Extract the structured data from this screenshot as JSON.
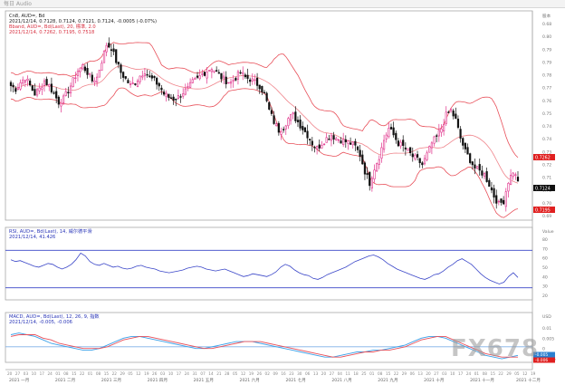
{
  "window": {
    "title": "每日 Audio"
  },
  "watermark": "FX678",
  "colors": {
    "bull": "#e0308a",
    "bear": "#111111",
    "band": "#e8505a",
    "rsi": "#3a46c8",
    "hline": "#3a46c8",
    "macd": "#3aa0e8",
    "signal": "#e8505a",
    "price_box": "#e02020",
    "cur_box": "#111111"
  },
  "panels": {
    "price": {
      "header": [
        "Cn8, AUD=, Bd",
        "2021/12/14, 0.7128, 0.7124, 0.7121, 0.7124, -0.0005 (-0.07%)",
        "Bband, AUD=, Bd(Last), 20, 標準, 2.0",
        "2021/12/14, 0.7262, 0.7195, 0.7518"
      ],
      "axis": [
        "0.68",
        "0.80",
        "0.79",
        "0.79",
        "0.78",
        "0.77",
        "0.76",
        "0.75",
        "0.74",
        "0.74",
        "0.73",
        "0.72",
        "0.71",
        "0.71",
        "0.70",
        "0.69"
      ],
      "axis_top": "股本",
      "tags": [
        {
          "text": "0.7262",
          "kind": "band"
        },
        {
          "text": "0.7124",
          "kind": "cur"
        },
        {
          "text": "0.7195",
          "kind": "band"
        }
      ]
    },
    "rsi": {
      "header": [
        "RSI, AUD=, Bd(Last), 14, 威尔德平滑",
        "2021/12/14, 41.426"
      ],
      "axis": [
        "80",
        "70",
        "60",
        "50",
        "40",
        "30",
        "20"
      ],
      "axis_top": "Value"
    },
    "macd": {
      "header": [
        "MACD, AUD=, Bd(Last), 12, 26, 9, 指数",
        "2021/12/14, -0.005, -0.006"
      ],
      "axis": [
        "0.01",
        "0.005",
        "0",
        "-0.005"
      ],
      "axis_top": "USD",
      "tags": [
        {
          "text": "-0.005",
          "kind": "macd"
        },
        {
          "text": "-0.006",
          "kind": "signal"
        }
      ]
    }
  },
  "x_axis": {
    "top_ticks": [
      "20",
      "27",
      "03",
      "10",
      "17",
      "24",
      "01",
      "08",
      "15",
      "22",
      "01",
      "08",
      "15",
      "22",
      "29",
      "05",
      "12",
      "19",
      "26",
      "03",
      "10",
      "17",
      "24",
      "31",
      "07",
      "14",
      "21",
      "28",
      "05",
      "12",
      "19",
      "26",
      "02",
      "09",
      "16",
      "23",
      "30",
      "06",
      "13",
      "20",
      "27",
      "04",
      "11",
      "18",
      "25",
      "01",
      "08",
      "15",
      "22",
      "29",
      "06",
      "13",
      "20",
      "27",
      "03",
      "10",
      "17",
      "24",
      "01",
      "08",
      "15",
      "22",
      "29",
      "05",
      "12",
      "19"
    ],
    "months": [
      "2021 一月",
      "2021 二月",
      "2021 三月",
      "2021 四月",
      "2021 五月",
      "2021 六月",
      "2021 七月",
      "2021 八月",
      "2021 九月",
      "2021 十月",
      "2021 十一月",
      "2021 十二月"
    ]
  },
  "chart_data": [
    {
      "type": "candlestick",
      "title": "",
      "instrument": "AUD=",
      "interval": "Daily",
      "ylim": [
        0.69,
        0.8
      ],
      "bands": {
        "period": 20,
        "stddev": 2.0
      },
      "close_path": [
        0.77,
        0.768,
        0.772,
        0.775,
        0.77,
        0.765,
        0.768,
        0.773,
        0.77,
        0.765,
        0.76,
        0.762,
        0.767,
        0.773,
        0.779,
        0.782,
        0.778,
        0.773,
        0.775,
        0.785,
        0.795,
        0.793,
        0.785,
        0.778,
        0.774,
        0.77,
        0.772,
        0.776,
        0.779,
        0.775,
        0.773,
        0.77,
        0.765,
        0.763,
        0.762,
        0.763,
        0.766,
        0.768,
        0.772,
        0.774,
        0.777,
        0.779,
        0.781,
        0.778,
        0.775,
        0.773,
        0.772,
        0.775,
        0.778,
        0.775,
        0.774,
        0.772,
        0.77,
        0.765,
        0.755,
        0.748,
        0.743,
        0.745,
        0.75,
        0.752,
        0.748,
        0.744,
        0.74,
        0.735,
        0.732,
        0.735,
        0.738,
        0.74,
        0.738,
        0.737,
        0.736,
        0.735,
        0.733,
        0.728,
        0.718,
        0.711,
        0.72,
        0.727,
        0.737,
        0.744,
        0.74,
        0.735,
        0.733,
        0.73,
        0.727,
        0.725,
        0.722,
        0.728,
        0.735,
        0.739,
        0.744,
        0.752,
        0.755,
        0.749,
        0.738,
        0.73,
        0.725,
        0.72,
        0.718,
        0.716,
        0.71,
        0.703,
        0.698,
        0.7,
        0.712,
        0.718,
        0.712
      ],
      "x_dates": [
        "2021-01-15",
        "2021-12-14"
      ],
      "last": {
        "open": 0.7128,
        "high": 0.7124,
        "low": 0.7121,
        "close": 0.7124
      },
      "bollinger_last": {
        "upper": 0.7262,
        "middle": 0.7195,
        "lower": 0.7518
      }
    },
    {
      "type": "line",
      "title": "",
      "ylim": [
        20,
        80
      ],
      "levels": [
        70,
        30
      ],
      "series": [
        {
          "values": [
            60,
            58,
            59,
            57,
            55,
            53,
            52,
            54,
            56,
            55,
            52,
            50,
            52,
            55,
            60,
            67,
            64,
            58,
            55,
            54,
            56,
            54,
            52,
            53,
            51,
            50,
            51,
            53,
            54,
            52,
            51,
            50,
            48,
            47,
            46,
            47,
            48,
            49,
            51,
            52,
            53,
            52,
            50,
            49,
            48,
            49,
            50,
            48,
            46,
            44,
            42,
            43,
            45,
            44,
            43,
            42,
            44,
            47,
            52,
            55,
            53,
            49,
            46,
            44,
            43,
            40,
            39,
            41,
            44,
            46,
            48,
            50,
            52,
            55,
            58,
            60,
            62,
            64,
            65,
            63,
            60,
            56,
            53,
            50,
            48,
            46,
            44,
            42,
            40,
            39,
            41,
            44,
            45,
            48,
            52,
            55,
            59,
            61,
            58,
            55,
            50,
            45,
            41,
            38,
            36,
            34,
            36,
            42,
            46,
            41
          ]
        }
      ],
      "last": 41.426
    },
    {
      "type": "line",
      "title": "",
      "ylim": [
        -0.008,
        0.012
      ],
      "zero_line": 0,
      "series": [
        {
          "values": [
            0.007,
            0.008,
            0.007,
            0.006,
            0.004,
            0.002,
            0.001,
            0.0,
            -0.001,
            -0.002,
            -0.002,
            -0.001,
            0.001,
            0.003,
            0.005,
            0.006,
            0.006,
            0.005,
            0.004,
            0.003,
            0.002,
            0.001,
            0.0,
            -0.001,
            -0.001,
            0.0,
            0.001,
            0.002,
            0.003,
            0.003,
            0.003,
            0.002,
            0.001,
            0.0,
            -0.001,
            -0.002,
            -0.003,
            -0.004,
            -0.005,
            -0.006,
            -0.006,
            -0.005,
            -0.004,
            -0.003,
            -0.003,
            -0.002,
            -0.002,
            -0.001,
            0.0,
            0.001,
            0.003,
            0.005,
            0.006,
            0.006,
            0.005,
            0.003,
            0.001,
            -0.001,
            -0.003,
            -0.005,
            -0.006,
            -0.007,
            -0.006,
            -0.005
          ]
        },
        {
          "values": [
            0.006,
            0.007,
            0.007,
            0.007,
            0.005,
            0.004,
            0.002,
            0.001,
            0.0,
            -0.001,
            -0.001,
            -0.001,
            0.0,
            0.002,
            0.004,
            0.005,
            0.006,
            0.006,
            0.005,
            0.004,
            0.003,
            0.002,
            0.001,
            0.0,
            -0.001,
            -0.001,
            0.0,
            0.001,
            0.002,
            0.003,
            0.003,
            0.003,
            0.002,
            0.001,
            0.0,
            -0.001,
            -0.002,
            -0.003,
            -0.004,
            -0.005,
            -0.006,
            -0.006,
            -0.005,
            -0.004,
            -0.003,
            -0.003,
            -0.002,
            -0.002,
            -0.001,
            0.0,
            0.002,
            0.004,
            0.005,
            0.006,
            0.006,
            0.004,
            0.002,
            0.0,
            -0.002,
            -0.004,
            -0.005,
            -0.006,
            -0.006,
            -0.006
          ]
        }
      ],
      "last": {
        "macd": -0.005,
        "signal": -0.006
      }
    }
  ]
}
